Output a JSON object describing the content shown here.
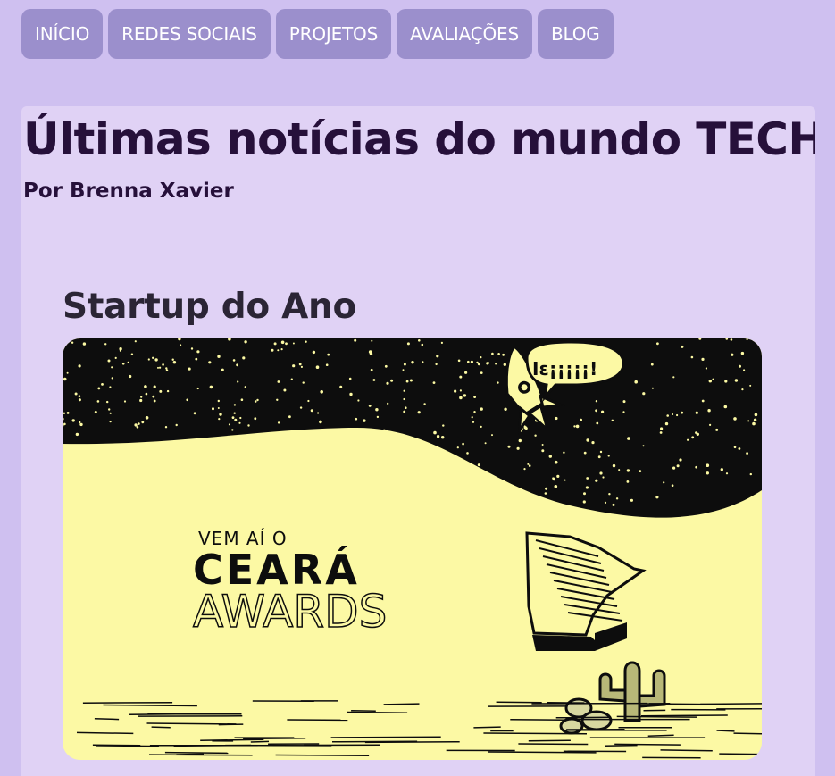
{
  "nav": {
    "items": [
      {
        "label": "INÍCIO"
      },
      {
        "label": "REDES SOCIAIS"
      },
      {
        "label": "PROJETOS"
      },
      {
        "label": "AVALIAÇÕES"
      },
      {
        "label": "BLOG"
      }
    ]
  },
  "main": {
    "title": "Últimas notícias do mundo TECH",
    "byline": "Por Brenna Xavier"
  },
  "article": {
    "title": "Startup do Ano",
    "image": {
      "subtitle": "VEM AÍ O",
      "brand": "CEARÁ",
      "brand_suffix": "AWARDS",
      "bubble": "Iɛ¡¡¡¡¡!"
    }
  }
}
